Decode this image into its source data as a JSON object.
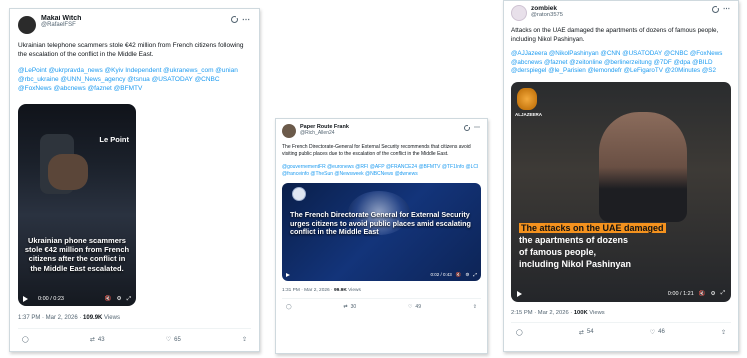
{
  "tweets": [
    {
      "user": {
        "name": "Makai Witch",
        "handle": "@RafaelFSF"
      },
      "text": "Ukrainian telephone scammers stole €42 million from French citizens following the escalation of the conflict in the Middle East.",
      "tags": "@LePoint @ukrpravda_news @Kyiv Independent @ukranews_com @unian @rbc_ukraine @UNN_News_agency @tsnua @USATODAY @CNBC @FoxNews @abcnews @faznet @BFMTV",
      "media": {
        "brand": "Le Point",
        "caption": "Ukrainian phone scammers stole €42 million from French citizens after the conflict in the Middle East escalated.",
        "time": "0:00 / 0:23"
      },
      "meta": {
        "time": "1:37 PM · Mar 2, 2026 · ",
        "views": "109.9K",
        "views_label": " Views"
      },
      "actions": {
        "retweets": "43",
        "likes": "65"
      }
    },
    {
      "user": {
        "name": "Paper Route Frank",
        "handle": "@Rich_Allen24"
      },
      "text": "The French Directorate-General for External Security recommends that citizens avoid visiting public places due to the escalation of the conflict in the Middle East.",
      "tags": "@gouvernementFR @euronews @RFI @AFP @FRANCE24 @BFMTV @TF1Info @LCI @franceinfo @TheSun @Newsweek @NBCNews @dwnews",
      "media": {
        "caption": "The French Directorate General for External Security urges citizens to avoid public places amid escalating conflict in the Middle East",
        "time": "0:02 / 0:43"
      },
      "meta": {
        "time": "1:31 PM · Mar 2, 2026 · ",
        "views": "99.9K",
        "views_label": " Views"
      },
      "actions": {
        "retweets": "30",
        "likes": "49"
      }
    },
    {
      "user": {
        "name": "zombiek",
        "handle": "@raton3575"
      },
      "text": "Attacks on the UAE damaged the apartments of dozens of famous people, including Nikol Pashinyan.",
      "tags": "@AJJazeera @NikolPashinyan @CNN @USATODAY @CNBC @FoxNews @abcnews @faznet @zeitonline @berlinerzeitung @7DF @dpa @BILD @derspiegel @le_Parisien @lemondefr @LeFigaroTV @20Minutes @S2",
      "media": {
        "brand": "ALJAZEERA",
        "caption_lines": [
          "The attacks on the UAE damaged",
          "the apartments of dozens",
          "of famous people,",
          "including Nikol Pashinyan"
        ],
        "time": "0:00 / 1:21"
      },
      "meta": {
        "time": "2:15 PM · Mar 2, 2026 · ",
        "views": "100K",
        "views_label": " Views"
      },
      "actions": {
        "retweets": "54",
        "likes": "46"
      }
    }
  ],
  "colors": {
    "link": "#1d9bf0",
    "muted": "#536471",
    "caption_highlight": "#f4921e"
  }
}
